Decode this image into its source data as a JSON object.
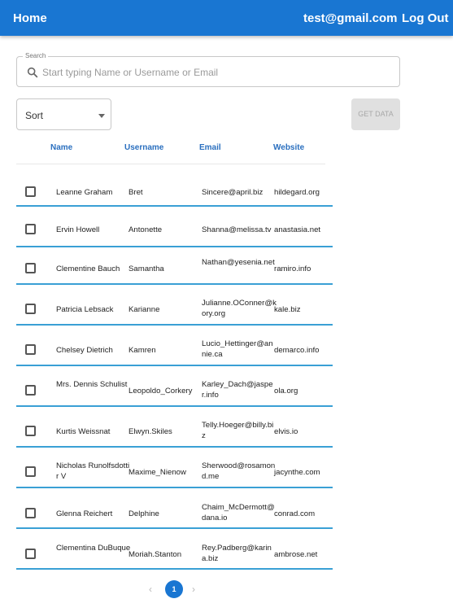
{
  "header": {
    "home": "Home",
    "user_email": "test@gmail.com",
    "logout": "Log Out"
  },
  "search": {
    "legend": "Search",
    "placeholder": "Start typing Name or Username or Email",
    "value": ""
  },
  "sort": {
    "selected": "Sort"
  },
  "get_data": {
    "label": "GET DATA",
    "disabled": true
  },
  "table": {
    "columns": [
      "Name",
      "Username",
      "Email",
      "Website"
    ],
    "rows": [
      {
        "name": "Leanne Graham",
        "username": "Bret",
        "email": "Sincere@april.biz",
        "website": "hildegard.org"
      },
      {
        "name": "Ervin Howell",
        "username": "Antonette",
        "email": "Shanna@melissa.tv",
        "website": "anastasia.net"
      },
      {
        "name": "Clementine Bauch",
        "username": "Samantha",
        "email": "Nathan@yesenia.net",
        "website": "ramiro.info"
      },
      {
        "name": "Patricia Lebsack",
        "username": "Karianne",
        "email": "Julianne.OConner@kory.org",
        "website": "kale.biz"
      },
      {
        "name": "Chelsey Dietrich",
        "username": "Kamren",
        "email": "Lucio_Hettinger@annie.ca",
        "website": "demarco.info"
      },
      {
        "name": "Mrs. Dennis Schulist",
        "username": "Leopoldo_Corkery",
        "email": "Karley_Dach@jasper.info",
        "website": "ola.org"
      },
      {
        "name": "Kurtis Weissnat",
        "username": "Elwyn.Skiles",
        "email": "Telly.Hoeger@billy.biz",
        "website": "elvis.io"
      },
      {
        "name": "Nicholas Runolfsdottir V",
        "username": "Maxime_Nienow",
        "email": "Sherwood@rosamond.me",
        "website": "jacynthe.com"
      },
      {
        "name": "Glenna Reichert",
        "username": "Delphine",
        "email": "Chaim_McDermott@dana.io",
        "website": "conrad.com"
      },
      {
        "name": "Clementina DuBuque",
        "username": "Moriah.Stanton",
        "email": "Rey.Padberg@karina.biz",
        "website": "ambrose.net"
      }
    ]
  },
  "pagination": {
    "current_page": "1",
    "prev_icon": "chevron-left-icon",
    "next_icon": "chevron-right-icon"
  },
  "colors": {
    "primary": "#1976d2",
    "row_divider": "#3aa0d5",
    "header_text": "#2a6fbf",
    "disabled_button": "#e0e0e0"
  }
}
